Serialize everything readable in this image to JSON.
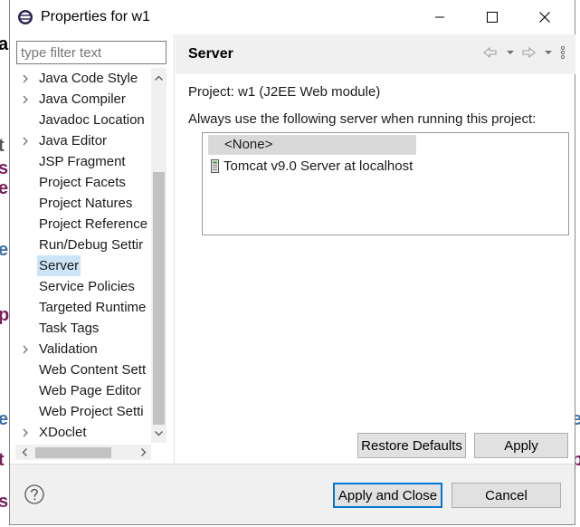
{
  "window": {
    "title": "Properties for w1"
  },
  "filter": {
    "placeholder": "type filter text"
  },
  "tree": {
    "items": [
      {
        "label": "Java Code Style",
        "expandable": true
      },
      {
        "label": "Java Compiler",
        "expandable": true
      },
      {
        "label": "Javadoc Location",
        "expandable": false
      },
      {
        "label": "Java Editor",
        "expandable": true
      },
      {
        "label": "JSP Fragment",
        "expandable": false
      },
      {
        "label": "Project Facets",
        "expandable": false
      },
      {
        "label": "Project Natures",
        "expandable": false
      },
      {
        "label": "Project Reference",
        "expandable": false
      },
      {
        "label": "Run/Debug Settir",
        "expandable": false
      },
      {
        "label": "Server",
        "expandable": false,
        "selected": true
      },
      {
        "label": "Service Policies",
        "expandable": false
      },
      {
        "label": "Targeted Runtime",
        "expandable": false
      },
      {
        "label": "Task Tags",
        "expandable": false
      },
      {
        "label": "Validation",
        "expandable": true
      },
      {
        "label": "Web Content Sett",
        "expandable": false
      },
      {
        "label": "Web Page Editor",
        "expandable": false
      },
      {
        "label": "Web Project Setti",
        "expandable": false
      },
      {
        "label": "XDoclet",
        "expandable": true
      }
    ]
  },
  "page": {
    "title": "Server",
    "project_line": "Project: w1 (J2EE Web module)",
    "server_prompt": "Always use the following server when running this project:",
    "servers": [
      {
        "label": "<None>",
        "selected": true
      },
      {
        "label": "Tomcat v9.0 Server at localhost"
      }
    ],
    "restore_defaults_label": "Restore Defaults",
    "apply_label": "Apply"
  },
  "footer": {
    "apply_close_label": "Apply and Close",
    "cancel_label": "Cancel"
  },
  "colors": {
    "selection": "#cce4f7",
    "accent": "#0078d7",
    "panel": "#f0f0f0"
  }
}
